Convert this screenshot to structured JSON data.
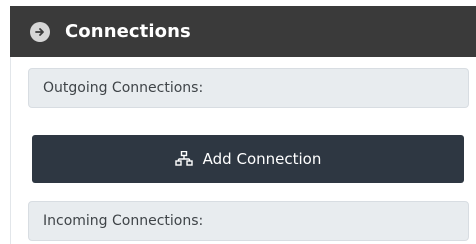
{
  "panel": {
    "title": "Connections",
    "title_icon": "arrow-right-circle-icon"
  },
  "sections": {
    "outgoing_label": "Outgoing Connections:",
    "incoming_label": "Incoming Connections:"
  },
  "actions": {
    "add_connection_label": "Add Connection",
    "add_connection_icon": "network-icon"
  },
  "colors": {
    "header_bg": "#3a3a3a",
    "button_bg": "#2e3742",
    "section_bg": "#e8ecef"
  }
}
